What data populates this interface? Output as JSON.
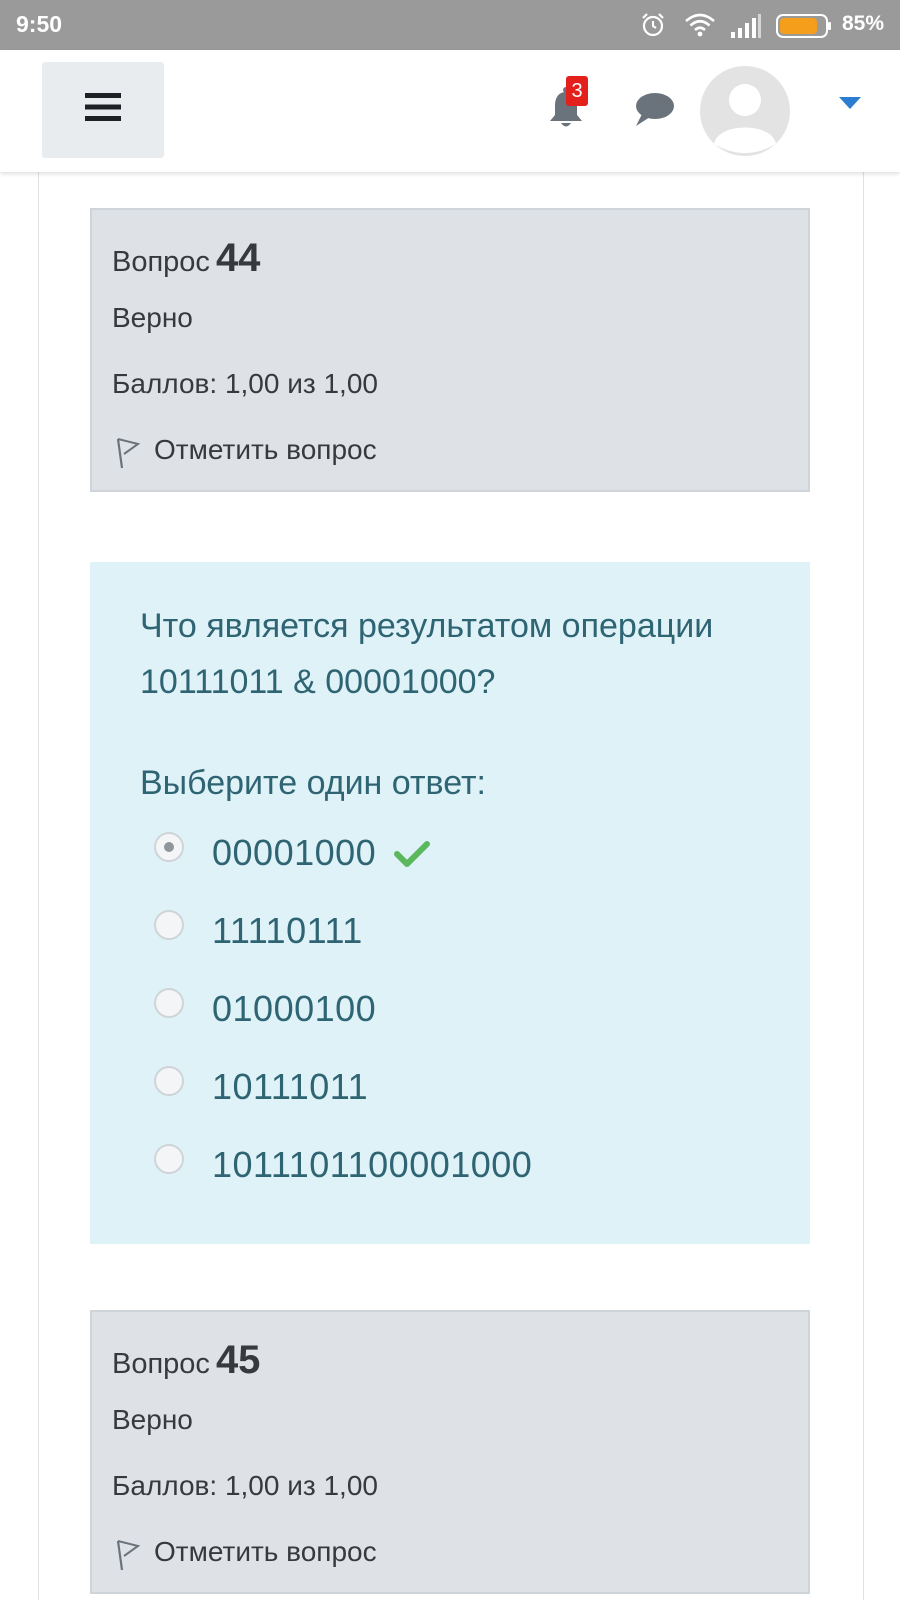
{
  "status_bar": {
    "time": "9:50",
    "battery_percent": "85%",
    "battery_level": 0.85,
    "icons": [
      "alarm-icon",
      "wifi-icon",
      "signal-icon",
      "battery-icon"
    ]
  },
  "navbar": {
    "menu_icon": "hamburger-icon",
    "notifications_count": "3",
    "icons": [
      "bell-icon",
      "chat-icon",
      "avatar",
      "caret-down-icon"
    ]
  },
  "question_44": {
    "label": "Вопрос",
    "number": "44",
    "state": "Верно",
    "grade": "Баллов: 1,00 из 1,00",
    "flag_label": "Отметить вопрос"
  },
  "question_content": {
    "text": "Что является результатом операции 10111011 & 00001000?",
    "prompt": "Выберите один ответ:",
    "answers": [
      {
        "label": "00001000",
        "selected": true,
        "correct": true
      },
      {
        "label": "11110111",
        "selected": false
      },
      {
        "label": "01000100",
        "selected": false
      },
      {
        "label": "10111011",
        "selected": false
      },
      {
        "label": "1011101100001000",
        "selected": false
      }
    ]
  },
  "question_45": {
    "label": "Вопрос",
    "number": "45",
    "state": "Верно",
    "grade": "Баллов: 1,00 из 1,00",
    "flag_label": "Отметить вопрос"
  },
  "colors": {
    "status_bar": "#9a9a9a",
    "info_bg": "#dee2e6",
    "content_bg": "#def2f8",
    "content_text": "#2f6473",
    "correct": "#5cb85c",
    "badge": "#e4201c",
    "caret": "#2b7dd1",
    "battery_fill": "#f59e1b"
  }
}
